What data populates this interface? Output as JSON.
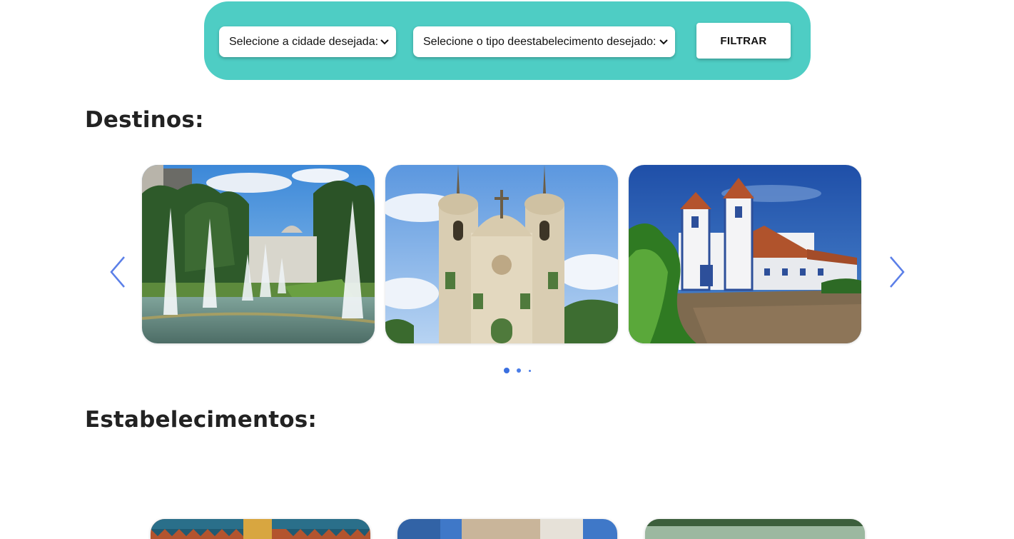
{
  "filter": {
    "city_select": "Selecione a cidade desejada:",
    "type_select": "Selecione o tipo deestabelecimento desejado:",
    "button_label": "FILTRAR"
  },
  "sections": {
    "destinos_title": "Destinos:",
    "estabelecimentos_title": "Estabelecimentos:"
  },
  "carousel": {
    "cards": [
      {
        "icon": "fountain-park-photo"
      },
      {
        "icon": "baroque-church-photo"
      },
      {
        "icon": "white-blue-church-photo"
      }
    ],
    "active_dot": 1,
    "dot_count": 3
  },
  "colors": {
    "accent": "#4ecdc4",
    "arrow": "#5b7fe8",
    "dot": "#3a6fe0"
  }
}
